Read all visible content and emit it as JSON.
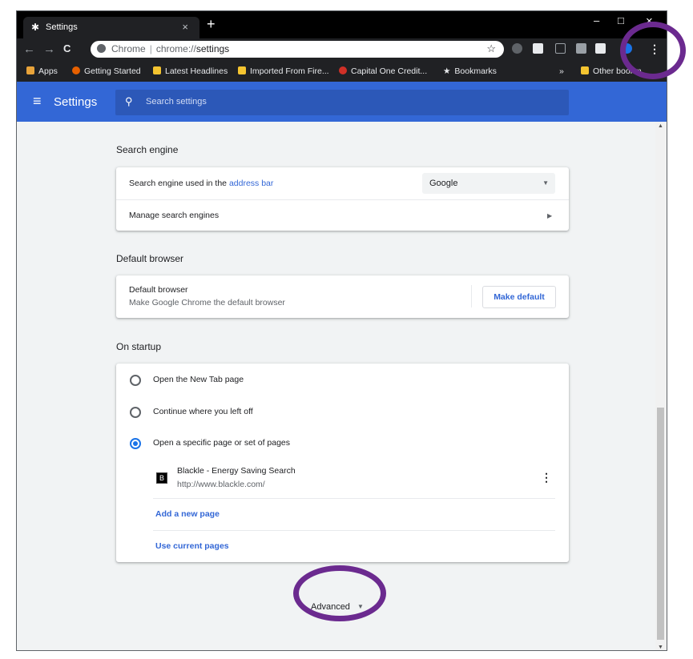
{
  "tab": {
    "title": "Settings",
    "close": "×",
    "new_tab": "+"
  },
  "window_controls": {
    "minimize": "–",
    "maximize": "□",
    "close": "×"
  },
  "nav": {
    "back": "←",
    "forward": "→",
    "reload": "C"
  },
  "omnibox": {
    "site": "Chrome",
    "separator": "|",
    "url_prefix": "chrome://",
    "url_path": "settings",
    "star": "☆"
  },
  "bookmarks": {
    "items": [
      "Apps",
      "Getting Started",
      "Latest Headlines",
      "Imported From Fire...",
      "Capital One Credit...",
      "Bookmarks"
    ],
    "overflow": "»",
    "other": "Other bookm"
  },
  "header": {
    "title": "Settings",
    "menu_icon": "≡",
    "search_icon": "🔍",
    "search_placeholder": "Search settings"
  },
  "search_engine": {
    "section_title": "Search engine",
    "used_label": "Search engine used in the ",
    "used_link": "address bar",
    "selected": "Google",
    "manage_label": "Manage search engines"
  },
  "default_browser": {
    "section_title": "Default browser",
    "title": "Default browser",
    "subtitle": "Make Google Chrome the default browser",
    "button": "Make default"
  },
  "on_startup": {
    "section_title": "On startup",
    "options": [
      "Open the New Tab page",
      "Continue where you left off",
      "Open a specific page or set of pages"
    ],
    "selected_index": 2,
    "page": {
      "favicon": "B",
      "title": "Blackle - Energy Saving Search",
      "url": "http://www.blackle.com/"
    },
    "add_page": "Add a new page",
    "use_current": "Use current pages"
  },
  "advanced": {
    "label": "Advanced",
    "arrow": "▼"
  },
  "colors": {
    "header": "#3367d6",
    "accent": "#3367d6",
    "highlight_circle": "#6b2a8f"
  }
}
